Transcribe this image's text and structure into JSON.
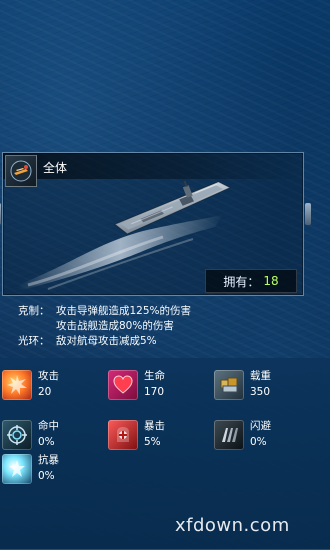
{
  "header": {
    "class_name": "全体",
    "owned_label": "拥有：",
    "owned_count": "18"
  },
  "description": {
    "rows": [
      {
        "label": "克制：",
        "text": "攻击导弹舰造成125%的伤害"
      },
      {
        "label": "",
        "text": "攻击战舰造成80%的伤害"
      },
      {
        "label": "光环：",
        "text": "敌对航母攻击减成5%"
      }
    ]
  },
  "stats": [
    {
      "name": "攻击",
      "value": "20",
      "icon": "explosion-icon"
    },
    {
      "name": "生命",
      "value": "170",
      "icon": "heart-icon"
    },
    {
      "name": "载重",
      "value": "350",
      "icon": "cargo-icon"
    },
    {
      "name": "命中",
      "value": "0%",
      "icon": "target-icon"
    },
    {
      "name": "暴击",
      "value": "5%",
      "icon": "critical-icon"
    },
    {
      "name": "闪避",
      "value": "0%",
      "icon": "dodge-icon"
    },
    {
      "name": "抗暴",
      "value": "0%",
      "icon": "resist-icon"
    }
  ],
  "watermark": "xfdown.com",
  "colors": {
    "accent": "#b7ff62"
  }
}
